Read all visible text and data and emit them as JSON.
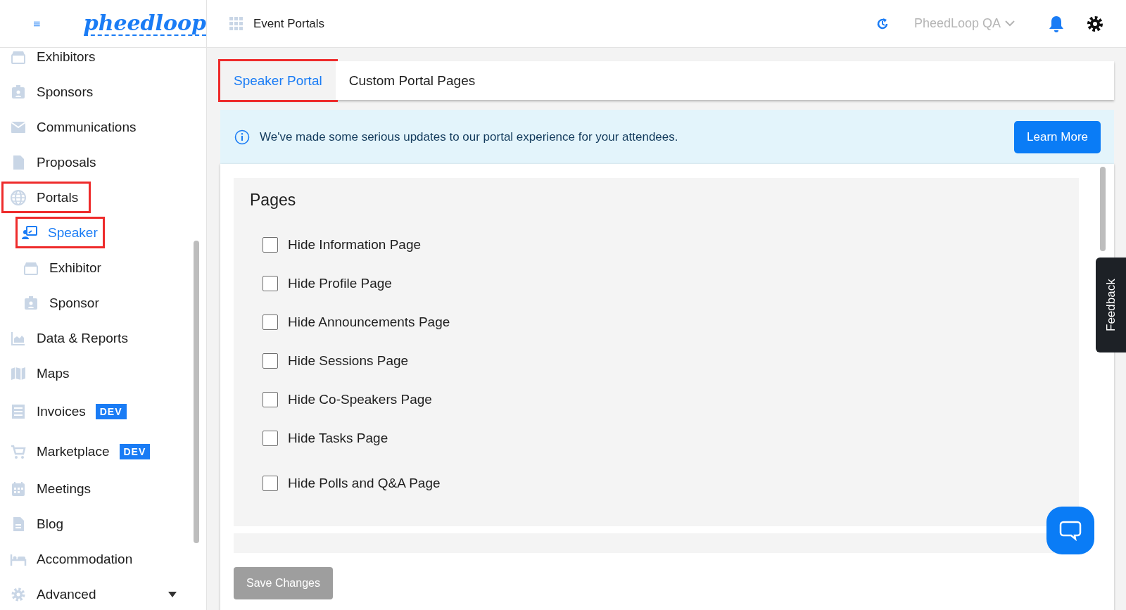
{
  "header": {
    "logo": "pheedloop",
    "page_title": "Event Portals",
    "account": "PheedLoop QA"
  },
  "sidebar": {
    "items": [
      {
        "label": "Exhibitors",
        "selected": false,
        "highlighted": false
      },
      {
        "label": "Sponsors",
        "selected": false,
        "highlighted": false
      },
      {
        "label": "Communications",
        "selected": false,
        "highlighted": false
      },
      {
        "label": "Proposals",
        "selected": false,
        "highlighted": false
      },
      {
        "label": "Portals",
        "selected": false,
        "highlighted": true,
        "children": [
          {
            "label": "Speaker",
            "selected": true,
            "highlighted": true
          },
          {
            "label": "Exhibitor",
            "selected": false,
            "highlighted": false
          },
          {
            "label": "Sponsor",
            "selected": false,
            "highlighted": false
          }
        ]
      },
      {
        "label": "Data & Reports",
        "selected": false,
        "highlighted": false
      },
      {
        "label": "Maps",
        "selected": false,
        "highlighted": false
      },
      {
        "label": "Invoices",
        "selected": false,
        "highlighted": false,
        "badge": "DEV"
      },
      {
        "label": "Marketplace",
        "selected": false,
        "highlighted": false,
        "badge": "DEV"
      },
      {
        "label": "Meetings",
        "selected": false,
        "highlighted": false
      },
      {
        "label": "Blog",
        "selected": false,
        "highlighted": false
      },
      {
        "label": "Accommodation",
        "selected": false,
        "highlighted": false
      },
      {
        "label": "Advanced",
        "selected": false,
        "highlighted": false,
        "expanded": false
      }
    ]
  },
  "tabs": [
    {
      "label": "Speaker Portal",
      "selected": true,
      "highlighted": true
    },
    {
      "label": "Custom Portal Pages",
      "selected": false,
      "highlighted": false
    }
  ],
  "banner": {
    "text": "We've made some serious updates to our portal experience for your attendees.",
    "button": "Learn More"
  },
  "pages_section": {
    "title": "Pages",
    "options": [
      {
        "label": "Hide Information Page",
        "checked": false
      },
      {
        "label": "Hide Profile Page",
        "checked": false
      },
      {
        "label": "Hide Announcements Page",
        "checked": false
      },
      {
        "label": "Hide Sessions Page",
        "checked": false
      },
      {
        "label": "Hide Co-Speakers Page",
        "checked": false
      },
      {
        "label": "Hide Tasks Page",
        "checked": false
      },
      {
        "label": "Hide Polls and Q&A Page",
        "checked": false
      }
    ]
  },
  "save_button": {
    "label": "Save Changes",
    "disabled": true
  },
  "feedback_tab": "Feedback"
}
